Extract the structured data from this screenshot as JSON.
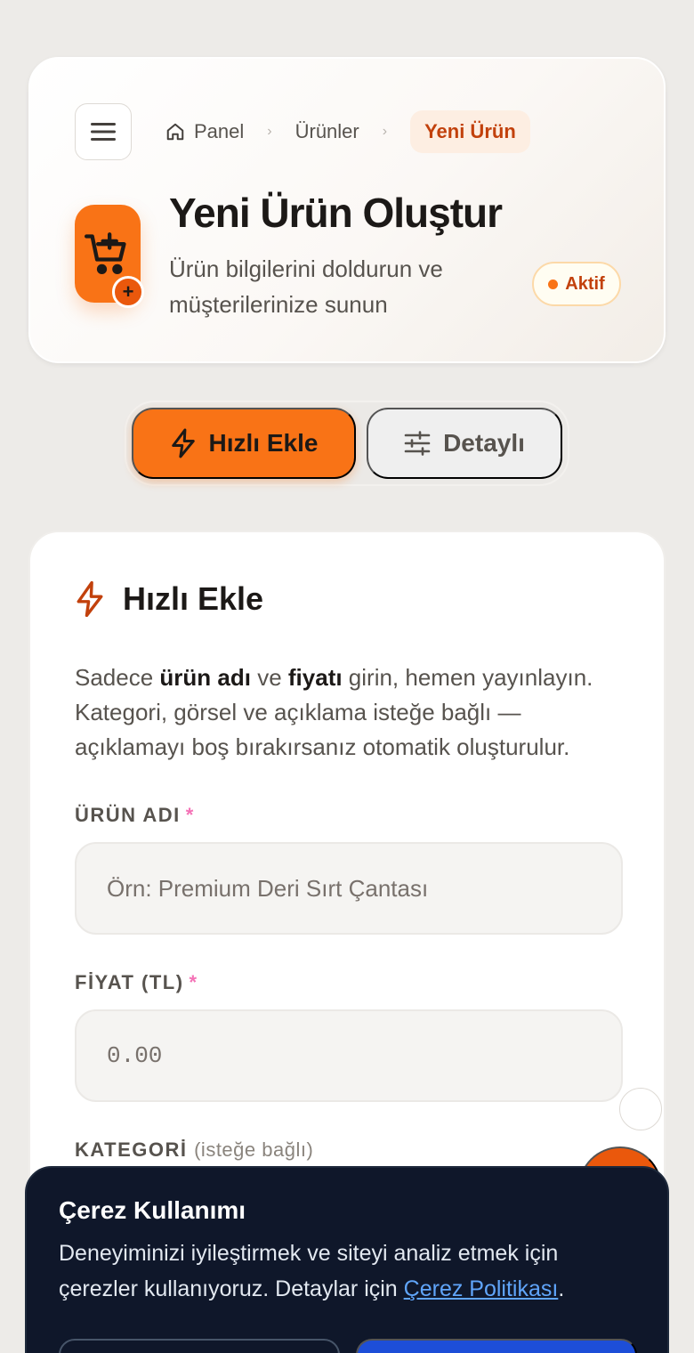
{
  "header": {
    "breadcrumb": {
      "home": "Panel",
      "products": "Ürünler",
      "current": "Yeni Ürün",
      "separator": "›"
    },
    "title": "Yeni Ürün Oluştur",
    "subtitle": "Ürün bilgilerini doldurun ve müşterilerinize sunun",
    "status": "Aktif",
    "icons": {
      "menu": "hamburger-icon",
      "home": "home-icon",
      "app": "cart-plus-icon",
      "plus": "+"
    }
  },
  "mode_toggle": {
    "quick": "Hızlı Ekle",
    "detailed": "Detaylı",
    "active": "quick"
  },
  "quick_add": {
    "title": "Hızlı Ekle",
    "description": {
      "part1": "Sadece ",
      "bold1": "ürün adı",
      "part2": " ve ",
      "bold2": "fiyatı",
      "part3": " girin, hemen yayınlayın. Kategori, görsel ve açıklama isteğe bağlı — açıklamayı boş bırakırsanız otomatik oluşturulur."
    },
    "fields": {
      "name_label": "ÜRÜN ADI",
      "name_placeholder": "Örn: Premium Deri Sırt Çantası",
      "name_value": "",
      "price_label": "FİYAT (TL)",
      "price_placeholder": "0.00",
      "price_value": "",
      "category_label": "KATEGORİ",
      "category_optional": "(isteğe bağlı)",
      "required_mark": "*"
    }
  },
  "cookie": {
    "title": "Çerez Kullanımı",
    "text": "Deneyiminizi iyileştirmek ve siteyi analiz etmek için çerezler kullanıyoruz. Detaylar için ",
    "link": "Çerez Politikası",
    "text_end": "."
  },
  "colors": {
    "accent": "#f97316",
    "accent_dark": "#c2410c",
    "background": "#edebe8",
    "cookie_bg": "#0f172a",
    "link": "#60a5fa"
  }
}
